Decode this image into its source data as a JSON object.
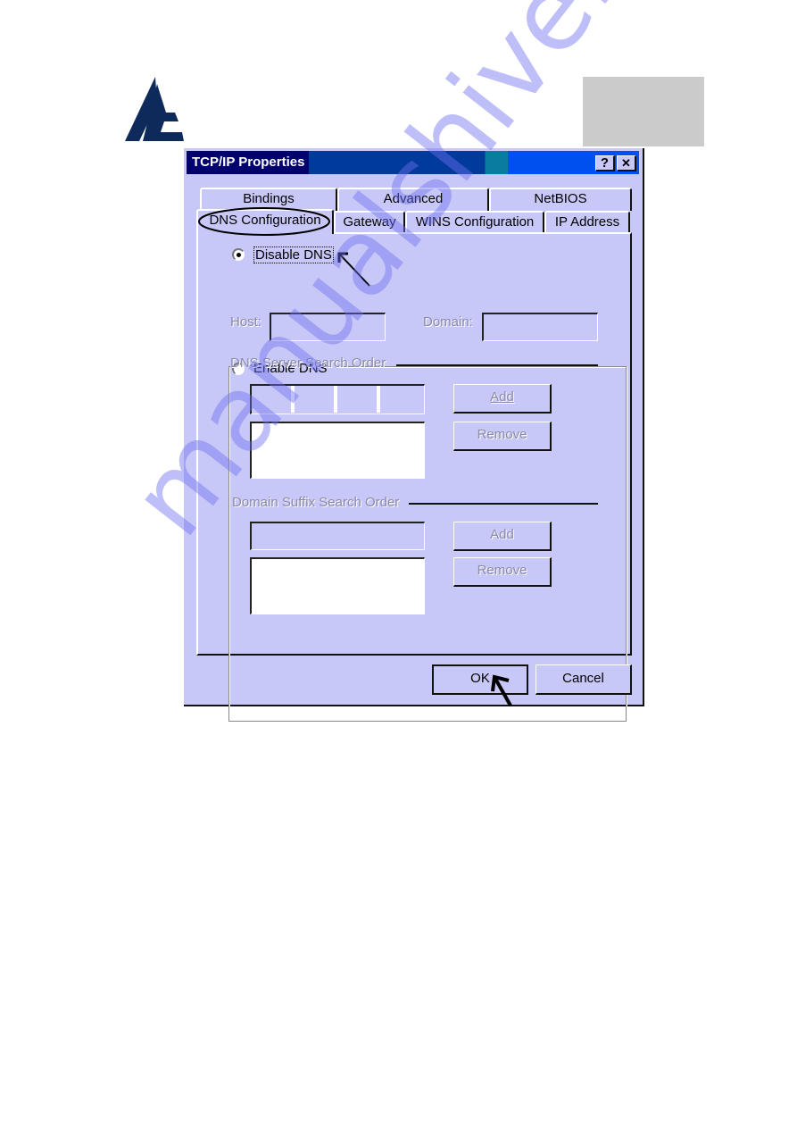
{
  "page": {
    "watermark": "manualshive.com",
    "logo_alt": "company-logo"
  },
  "dialog": {
    "title": "TCP/IP Properties",
    "help_button": "?",
    "close_button": "✕",
    "tabs_back_row": [
      "Bindings",
      "Advanced",
      "NetBIOS"
    ],
    "tabs_front_row": [
      "DNS Configuration",
      "Gateway",
      "WINS Configuration",
      "IP Address"
    ],
    "active_tab": "DNS Configuration",
    "dns": {
      "disable_label": "Disable DNS",
      "disable_selected": true,
      "enable_label": "Enable DNS",
      "enable_selected": false,
      "host_label": "Host:",
      "host_value": "",
      "domain_label": "Domain:",
      "domain_value": "",
      "server_order_label": "DNS Server Search Order",
      "server_ip_value": [
        "",
        "",
        "",
        ""
      ],
      "server_ip_separator": ".",
      "server_list": [],
      "server_add": "Add",
      "server_remove": "Remove",
      "suffix_order_label": "Domain Suffix Search Order",
      "suffix_value": "",
      "suffix_list": [],
      "suffix_add": "Add",
      "suffix_remove": "Remove"
    },
    "ok_label": "OK",
    "cancel_label": "Cancel"
  }
}
